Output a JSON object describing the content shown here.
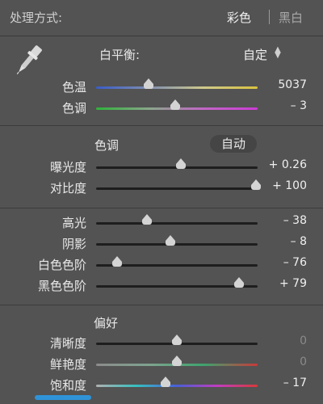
{
  "header": {
    "title": "处理方式:",
    "option_color": "彩色",
    "option_bw": "黑白",
    "selected": "彩色"
  },
  "white_balance": {
    "label": "白平衡:",
    "value": "自定",
    "updown_icon": "updown-arrows-icon",
    "eyedropper_icon": "eyedropper-icon",
    "sliders": [
      {
        "label": "色温",
        "value": "5037",
        "level": 0.32,
        "track": "temp"
      },
      {
        "label": "色调",
        "value": "– 3",
        "level": 0.49,
        "track": "tint"
      }
    ]
  },
  "tone": {
    "title": "色调",
    "auto_label": "自动",
    "sliders": [
      {
        "label": "曝光度",
        "value": "+ 0.26",
        "level": 0.525
      },
      {
        "label": "对比度",
        "value": "+ 100",
        "level": 1.0
      }
    ]
  },
  "tone2": {
    "sliders": [
      {
        "label": "高光",
        "value": "– 38",
        "level": 0.31
      },
      {
        "label": "阴影",
        "value": "– 8",
        "level": 0.46
      },
      {
        "label": "白色色阶",
        "value": "– 76",
        "level": 0.12
      },
      {
        "label": "黑色色阶",
        "value": "+ 79",
        "level": 0.895
      }
    ]
  },
  "presence": {
    "title": "偏好",
    "sliders": [
      {
        "label": "清晰度",
        "value": "0",
        "level": 0.5,
        "dim": true,
        "track": "gray"
      },
      {
        "label": "鲜艳度",
        "value": "0",
        "level": 0.5,
        "dim": true,
        "track": "vibrance"
      },
      {
        "label": "饱和度",
        "value": "– 17",
        "level": 0.43,
        "dim": false,
        "track": "saturation"
      }
    ]
  },
  "colors": {
    "background": "#535353",
    "accent_blue": "#2f93d8"
  }
}
